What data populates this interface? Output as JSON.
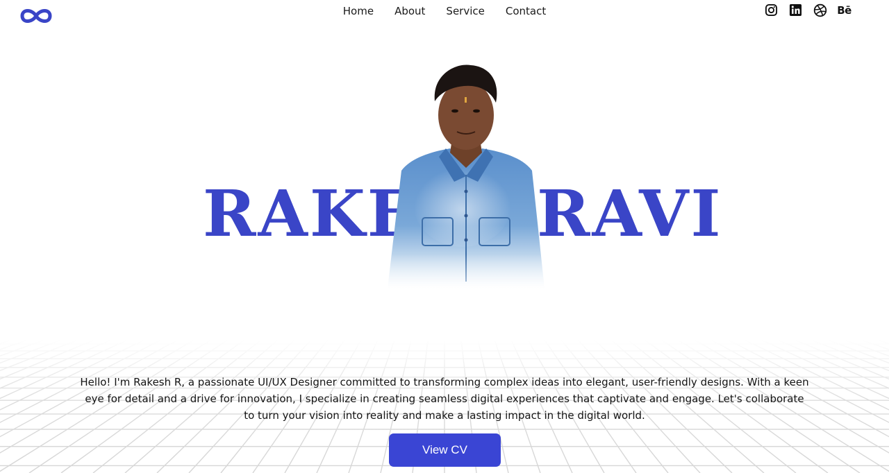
{
  "header": {
    "logo_icon": "infinity-icon",
    "nav": [
      {
        "label": "Home"
      },
      {
        "label": "About"
      },
      {
        "label": "Service"
      },
      {
        "label": "Contact"
      }
    ],
    "social": [
      {
        "icon": "instagram-icon"
      },
      {
        "icon": "linkedin-icon"
      },
      {
        "icon": "dribbble-icon"
      },
      {
        "icon": "behance-icon",
        "label": "Bē"
      }
    ]
  },
  "hero": {
    "name_first": "RAKE",
    "name_last": "RAVI",
    "bio": "Hello! I'm Rakesh R, a passionate UI/UX Designer committed to transforming complex ideas into elegant, user-friendly designs. With a keen eye for detail and a drive for innovation, I specialize in creating seamless digital experiences that captivate and engage. Let's collaborate to turn your vision into reality and make a lasting impact in the digital world.",
    "cta_label": "View CV"
  },
  "colors": {
    "accent": "#3a45c7",
    "button": "#3a45d4",
    "shirt": "#4f86c6",
    "skin": "#7a4a32",
    "hair": "#1b1412"
  }
}
